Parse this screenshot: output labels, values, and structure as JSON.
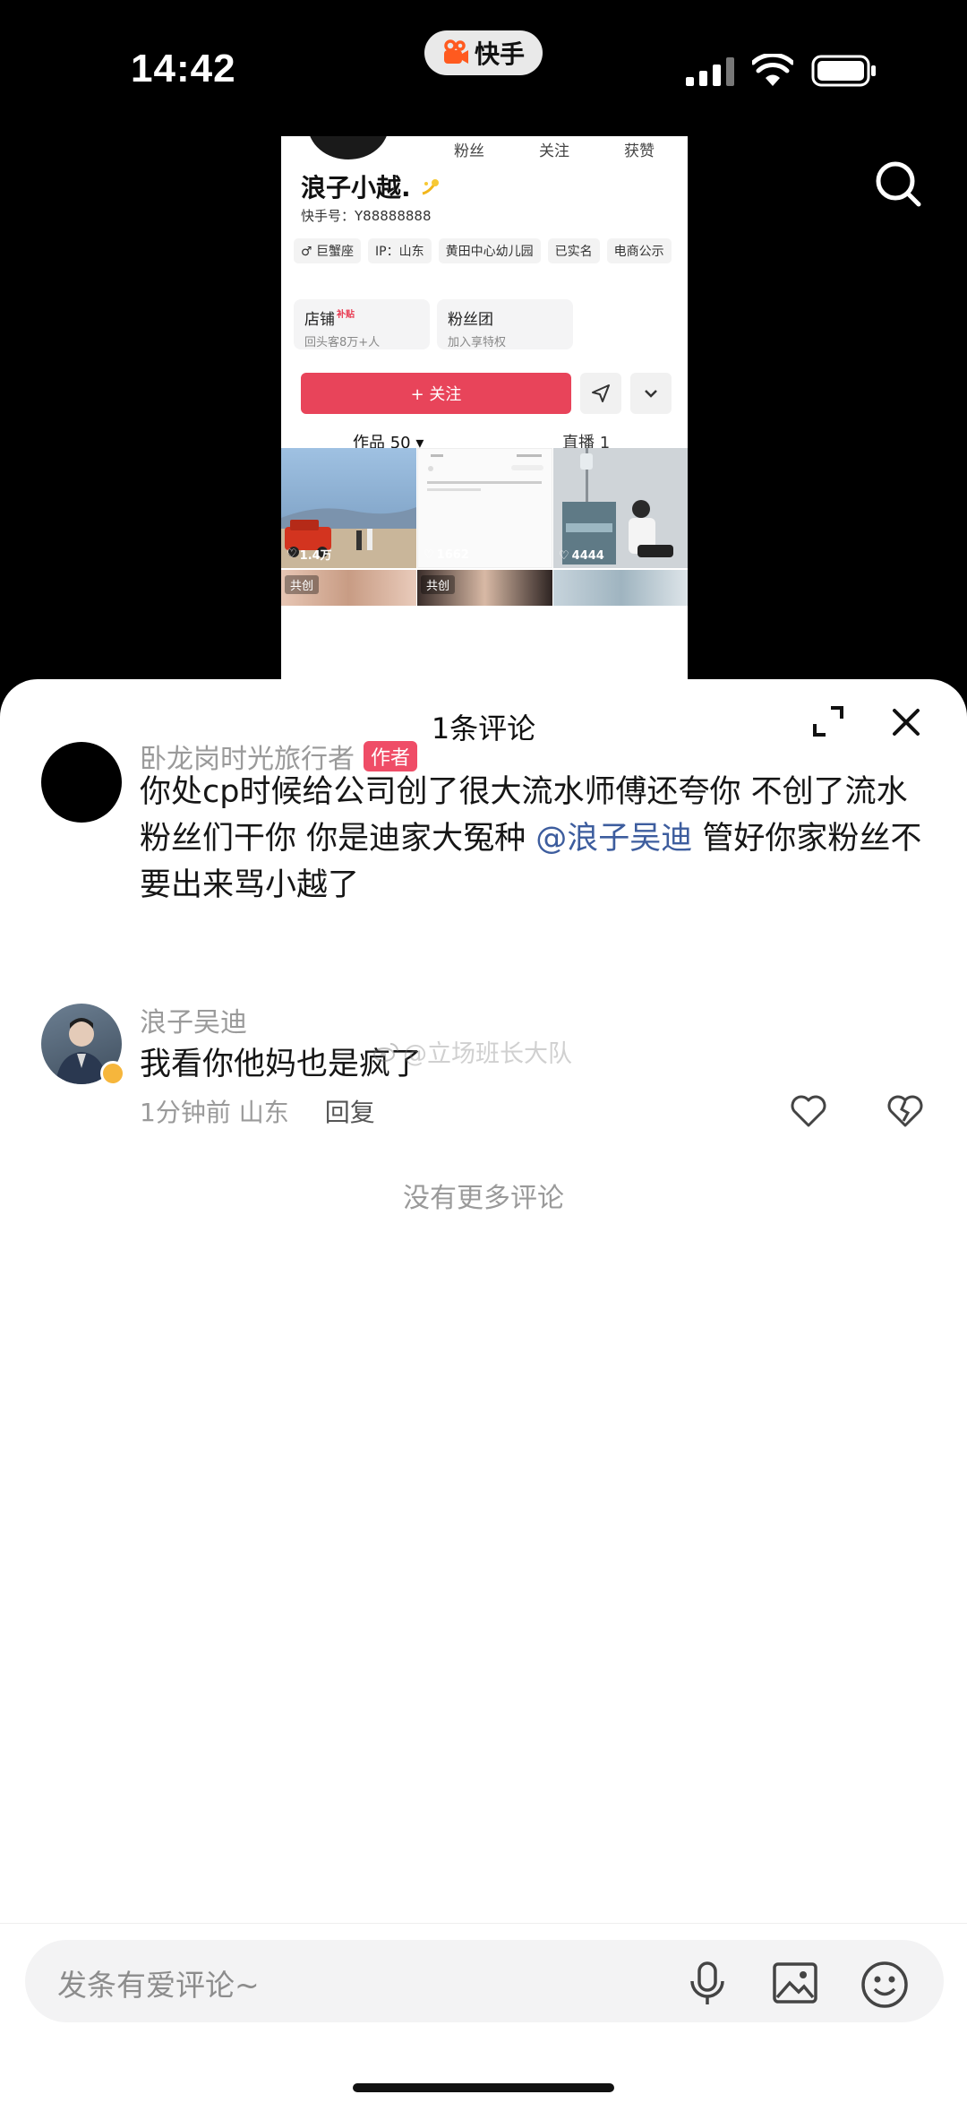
{
  "status_bar": {
    "time": "14:42",
    "app_name": "快手",
    "app_logo_color": "#ff5a1f"
  },
  "profile_preview": {
    "stats_labels": [
      "粉丝",
      "关注",
      "获赞"
    ],
    "name": "浪子小越.",
    "kuaishou_id": "快手号：Y88888888",
    "tags": [
      "♂ 巨蟹座",
      "IP：山东",
      "黄田中心幼儿园",
      "已实名",
      "电商公示"
    ],
    "cards": [
      {
        "title": "店铺",
        "badge": "补贴",
        "subtitle": "回头客8万+人"
      },
      {
        "title": "粉丝团",
        "badge": "",
        "subtitle": "加入享特权"
      }
    ],
    "follow_label": "+ 关注",
    "follow_color": "#e8445a",
    "tabs": {
      "works": "作品 50",
      "live": "直播 1"
    },
    "tiles": [
      {
        "likes": "1.4万",
        "badge": ""
      },
      {
        "likes": "1662",
        "badge": ""
      },
      {
        "likes": "4444",
        "badge": ""
      },
      {
        "likes": "",
        "badge": "共创"
      },
      {
        "likes": "",
        "badge": "共创"
      },
      {
        "likes": "",
        "badge": ""
      }
    ]
  },
  "comment_sheet": {
    "title": "1条评论",
    "comments": [
      {
        "user": "卧龙岗时光旅行者",
        "author_badge": "作者",
        "text_before": "你处cp时候给公司创了很大流水师傅还夸你 不创了流水粉丝们干你 你是迪家大冤种 ",
        "mention": "@浪子吴迪",
        "text_after": " 管好你家粉丝不要出来骂小越了"
      },
      {
        "user": "浪子吴迪",
        "text": "我看你他妈也是疯了",
        "time": "1分钟前",
        "location": "山东",
        "reply_label": "回复"
      }
    ],
    "no_more": "没有更多评论",
    "watermark": "@立场班长大队"
  },
  "input_bar": {
    "placeholder": "发条有爱评论~"
  },
  "colors": {
    "author_badge": "#ef4d67",
    "mention": "#3d5d9e",
    "secondary_text": "#9a9a9a"
  }
}
